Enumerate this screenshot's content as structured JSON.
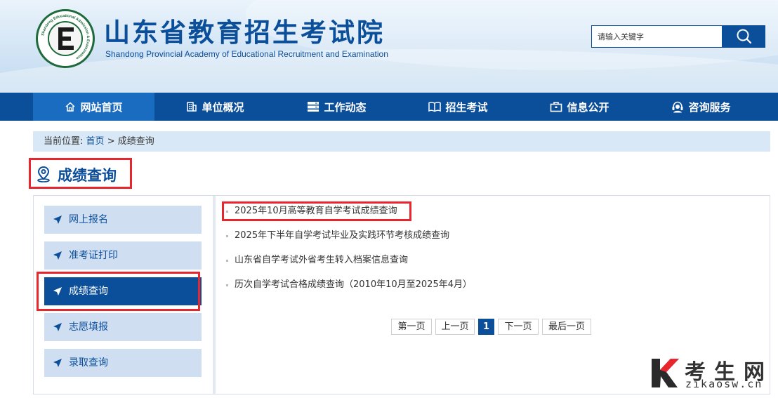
{
  "header": {
    "title": "山东省教育招生考试院",
    "subtitle": "Shandong Provincial Academy of Educational Recruitment and Examination",
    "logo_text": "Shandong Educational Admission & Examination",
    "search_placeholder": "请输入关键字",
    "search_icon": "search-icon"
  },
  "nav": {
    "items": [
      {
        "label": "网站首页",
        "icon": "home-icon"
      },
      {
        "label": "单位概况",
        "icon": "building-icon"
      },
      {
        "label": "工作动态",
        "icon": "server-icon"
      },
      {
        "label": "招生考试",
        "icon": "book-icon"
      },
      {
        "label": "信息公开",
        "icon": "briefcase-icon"
      },
      {
        "label": "咨询服务",
        "icon": "headset-icon"
      }
    ],
    "active_index": 0
  },
  "breadcrumb": {
    "prefix": "当前位置:",
    "home": "首页",
    "separator": ">",
    "current": "成绩查询"
  },
  "page_title": "成绩查询",
  "sidebar": {
    "items": [
      {
        "label": "网上报名"
      },
      {
        "label": "准考证打印"
      },
      {
        "label": "成绩查询"
      },
      {
        "label": "志愿填报"
      },
      {
        "label": "录取查询"
      }
    ],
    "active_index": 2
  },
  "list": {
    "items": [
      {
        "text": "2025年10月高等教育自学考试成绩查询"
      },
      {
        "text": "2025年下半年自学考试毕业及实践环节考核成绩查询"
      },
      {
        "text": "山东省自学考试外省考生转入档案信息查询"
      },
      {
        "text": "历次自学考试合格成绩查询（2010年10月至2025年4月）"
      }
    ]
  },
  "pagination": {
    "first": "第一页",
    "prev": "上一页",
    "current": "1",
    "next": "下一页",
    "last": "最后一页"
  },
  "watermark": {
    "text": "考生网",
    "url": "zikaosw.cn"
  },
  "colors": {
    "primary": "#0b4e9a",
    "nav_active": "#1a6cc1",
    "sidebar_bg": "#cfdff1",
    "highlight_red": "#e8262e",
    "breadcrumb_bg": "#d9e8f7"
  }
}
